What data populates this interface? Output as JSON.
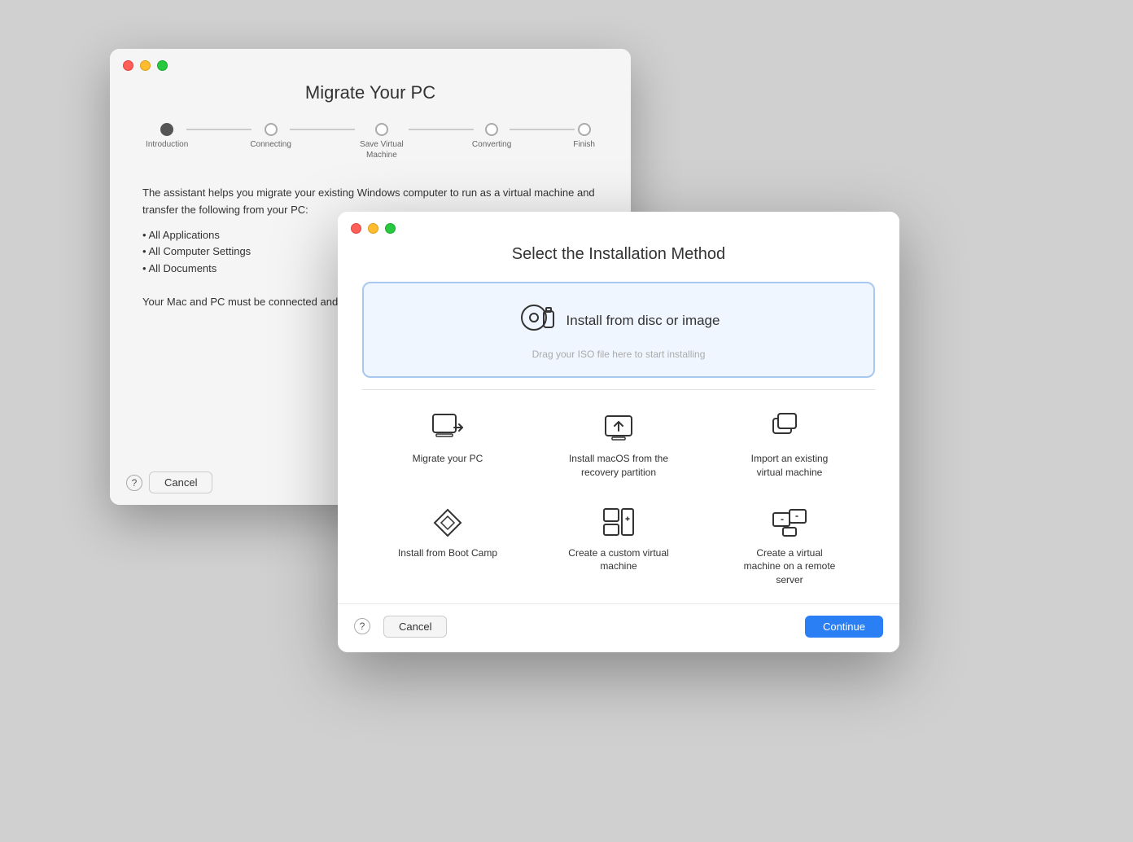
{
  "bgWindow": {
    "title": "Migrate Your PC",
    "steps": [
      {
        "label": "Introduction",
        "active": true
      },
      {
        "label": "Connecting",
        "active": false
      },
      {
        "label": "Save Virtual Machine",
        "active": false
      },
      {
        "label": "Converting",
        "active": false
      },
      {
        "label": "Finish",
        "active": false
      }
    ],
    "bodyText": "The assistant helps you migrate your existing Windows computer to run as a virtual machine and transfer the following from your PC:",
    "bulletPoints": [
      "All Applications",
      "All Computer Settings",
      "All Documents"
    ],
    "footerText": "Your Mac and PC must be connected and powered on during the migration.",
    "cancelLabel": "Cancel",
    "helpLabel": "?"
  },
  "fgWindow": {
    "title": "Select the Installation Method",
    "primaryOption": {
      "label": "Install from disc or image",
      "dragHint": "Drag your ISO file here to start installing"
    },
    "options": [
      {
        "id": "migrate-pc",
        "label": "Migrate your PC"
      },
      {
        "id": "install-macos",
        "label": "Install macOS from the recovery partition"
      },
      {
        "id": "import-vm",
        "label": "Import an existing virtual machine"
      },
      {
        "id": "boot-camp",
        "label": "Install from Boot Camp"
      },
      {
        "id": "custom-vm",
        "label": "Create a custom virtual machine"
      },
      {
        "id": "remote-vm",
        "label": "Create a virtual machine on a remote server"
      }
    ],
    "cancelLabel": "Cancel",
    "continueLabel": "Continue",
    "helpLabel": "?"
  }
}
